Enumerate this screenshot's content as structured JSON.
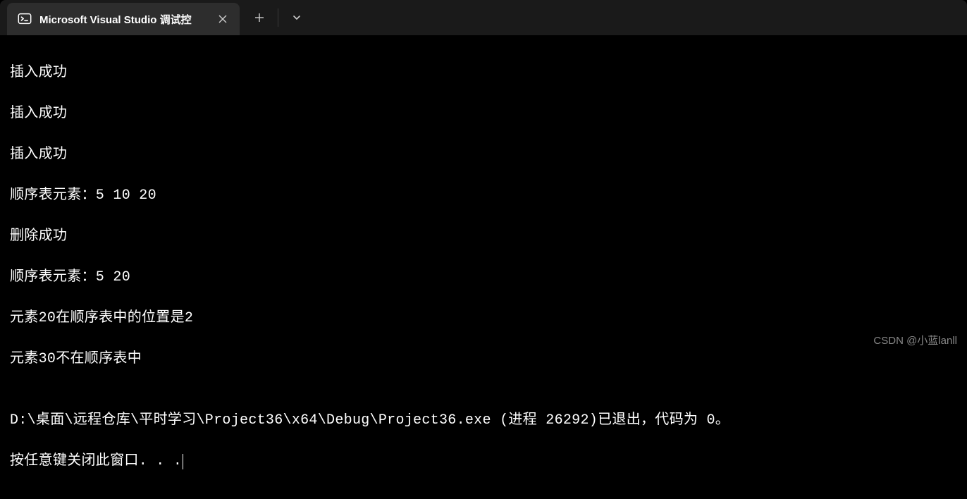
{
  "titlebar": {
    "tab_title": "Microsoft Visual Studio 调试控",
    "new_tab_symbol": "+",
    "dropdown_symbol": "⌄",
    "close_symbol": "✕"
  },
  "console": {
    "lines": [
      "插入成功",
      "插入成功",
      "插入成功",
      "顺序表元素：5 10 20",
      "删除成功",
      "顺序表元素：5 20",
      "元素20在顺序表中的位置是2",
      "元素30不在顺序表中",
      "",
      "D:\\桌面\\远程仓库\\平时学习\\Project36\\x64\\Debug\\Project36.exe (进程 26292)已退出，代码为 0。",
      "按任意键关闭此窗口. . ."
    ]
  },
  "watermark": "CSDN @小蓝lanll"
}
